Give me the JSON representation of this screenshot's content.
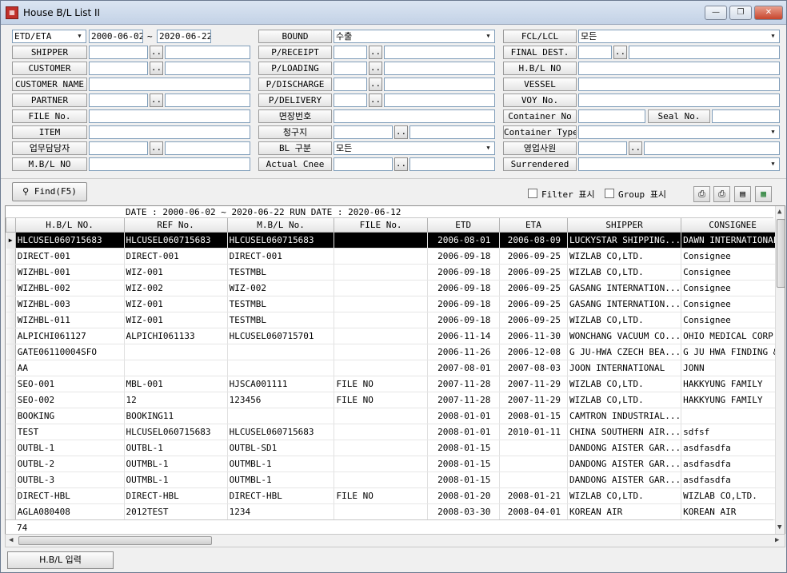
{
  "window": {
    "title": "House B/L List II",
    "icon": "app-icon",
    "min": "—",
    "max": "❐",
    "close": "✕"
  },
  "form": {
    "date_type": "ETD/ETA",
    "date_from": "2000-06-02",
    "date_sep": "~",
    "date_to": "2020-06-22",
    "bound_label": "BOUND",
    "bound_value": "수출",
    "fcl_label": "FCL/LCL",
    "fcl_value": "모든",
    "shipper_label": "SHIPPER",
    "receipt_label": "P/RECEIPT",
    "final_dest_label": "FINAL DEST.",
    "customer_label": "CUSTOMER",
    "loading_label": "P/LOADING",
    "hbl_no_label": "H.B/L NO",
    "customer_name_label": "CUSTOMER NAME",
    "discharge_label": "P/DISCHARGE",
    "vessel_label": "VESSEL",
    "partner_label": "PARTNER",
    "delivery_label": "P/DELIVERY",
    "voy_label": "VOY No.",
    "file_no_label": "FILE No.",
    "myeonjang_label": "면장번호",
    "container_no_label": "Container No",
    "seal_no_label": "Seal No.",
    "item_label": "ITEM",
    "billing_label": "청구지",
    "container_type_label": "Container Type",
    "staff_label": "업무담당자",
    "bl_type_label": "BL 구분",
    "bl_type_value": "모든",
    "sales_label": "영업사원",
    "mbl_no_label": "M.B/L NO",
    "actual_cnee_label": "Actual Cnee",
    "surrendered_label": "Surrendered",
    "dots": ".."
  },
  "toolbar": {
    "find_label": "Find(F5)",
    "filter_label": "Filter 표시",
    "group_label": "Group 표시"
  },
  "grid": {
    "info": "DATE : 2000-06-02 ~ 2020-06-22  RUN DATE : 2020-06-12",
    "columns": [
      "H.B/L NO.",
      "REF No.",
      "M.B/L No.",
      "FILE No.",
      "ETD",
      "ETA",
      "SHIPPER",
      "CONSIGNEE"
    ],
    "rows": [
      [
        "HLCUSEL060715683",
        "HLCUSEL060715683",
        "HLCUSEL060715683",
        "",
        "2006-08-01",
        "2006-08-09",
        "LUCKYSTAR SHIPPING...",
        "DAWN INTERNATIONAL."
      ],
      [
        "DIRECT-001",
        "DIRECT-001",
        "DIRECT-001",
        "",
        "2006-09-18",
        "2006-09-25",
        "WIZLAB CO,LTD.",
        "Consignee"
      ],
      [
        "WIZHBL-001",
        "WIZ-001",
        "TESTMBL",
        "",
        "2006-09-18",
        "2006-09-25",
        "WIZLAB CO,LTD.",
        "Consignee"
      ],
      [
        "WIZHBL-002",
        "WIZ-002",
        "WIZ-002",
        "",
        "2006-09-18",
        "2006-09-25",
        "GASANG INTERNATION...",
        "Consignee"
      ],
      [
        "WIZHBL-003",
        "WIZ-001",
        "TESTMBL",
        "",
        "2006-09-18",
        "2006-09-25",
        "GASANG INTERNATION...",
        "Consignee"
      ],
      [
        "WIZHBL-011",
        "WIZ-001",
        "TESTMBL",
        "",
        "2006-09-18",
        "2006-09-25",
        "WIZLAB CO,LTD.",
        "Consignee"
      ],
      [
        "ALPICHI061127",
        "ALPICHI061133",
        "HLCUSEL060715701",
        "",
        "2006-11-14",
        "2006-11-30",
        "WONCHANG VACUUM CO...",
        "OHIO MEDICAL CORP."
      ],
      [
        "GATE06110004SFO",
        "",
        "",
        "",
        "2006-11-26",
        "2006-12-08",
        "G JU-HWA CZECH BEA...",
        "G JU HWA FINDING &."
      ],
      [
        "AA",
        "",
        "",
        "",
        "2007-08-01",
        "2007-08-03",
        "JOON INTERNATIONAL",
        "JONN"
      ],
      [
        "SEO-001",
        "MBL-001",
        "HJSCA001111",
        "FILE NO",
        "2007-11-28",
        "2007-11-29",
        "WIZLAB CO,LTD.",
        "HAKKYUNG FAMILY"
      ],
      [
        "SEO-002",
        "12",
        "123456",
        "FILE NO",
        "2007-11-28",
        "2007-11-29",
        "WIZLAB CO,LTD.",
        "HAKKYUNG FAMILY"
      ],
      [
        "BOOKING",
        "BOOKING11",
        "",
        "",
        "2008-01-01",
        "2008-01-15",
        "CAMTRON INDUSTRIAL...",
        ""
      ],
      [
        "TEST",
        "HLCUSEL060715683",
        "HLCUSEL060715683",
        "",
        "2008-01-01",
        "2010-01-11",
        "CHINA SOUTHERN AIR...",
        "sdfsf"
      ],
      [
        "OUTBL-1",
        "OUTBL-1",
        "OUTBL-SD1",
        "",
        "2008-01-15",
        "",
        "DANDONG AISTER GAR...",
        "asdfasdfa"
      ],
      [
        "OUTBL-2",
        "OUTMBL-1",
        "OUTMBL-1",
        "",
        "2008-01-15",
        "",
        "DANDONG AISTER GAR...",
        "asdfasdfa"
      ],
      [
        "OUTBL-3",
        "OUTMBL-1",
        "OUTMBL-1",
        "",
        "2008-01-15",
        "",
        "DANDONG AISTER GAR...",
        "asdfasdfa"
      ],
      [
        "DIRECT-HBL",
        "DIRECT-HBL",
        "DIRECT-HBL",
        "FILE NO",
        "2008-01-20",
        "2008-01-21",
        "WIZLAB CO,LTD.",
        "WIZLAB CO,LTD."
      ],
      [
        "AGLA080408",
        "2012TEST",
        "1234",
        "",
        "2008-03-30",
        "2008-04-01",
        " KOREAN AIR",
        " KOREAN AIR"
      ]
    ],
    "selected_row": 0,
    "count": "74"
  },
  "bottom": {
    "hbl_input_label": "H.B/L 입력"
  }
}
